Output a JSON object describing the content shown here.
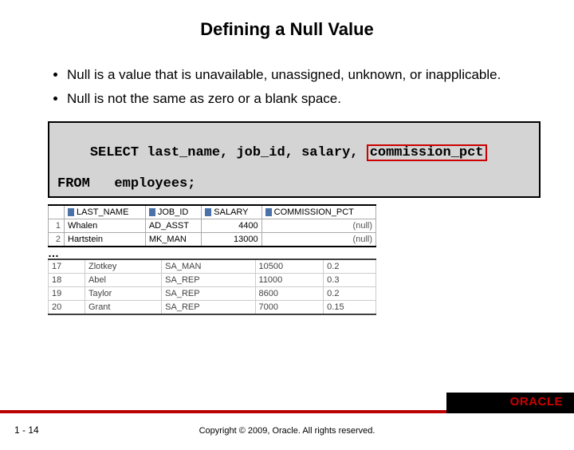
{
  "title": "Defining a Null Value",
  "bullets": [
    "Null is a value that is unavailable, unassigned, unknown, or inapplicable.",
    "Null is not the same as zero or a blank space."
  ],
  "sql": {
    "select_kw": "SELECT ",
    "cols_pre": "last_name, job_id, salary, ",
    "cols_hl": "commission_pct",
    "from_line": "FROM   employees;"
  },
  "grid_headers": [
    "LAST_NAME",
    "JOB_ID",
    "SALARY",
    "COMMISSION_PCT"
  ],
  "rows1": [
    {
      "n": "1",
      "last": "Whalen",
      "job": "AD_ASST",
      "sal": "4400",
      "comm": "(null)"
    },
    {
      "n": "2",
      "last": "Hartstein",
      "job": "MK_MAN",
      "sal": "13000",
      "comm": "(null)"
    }
  ],
  "rows2": [
    {
      "n": "17",
      "last": "Zlotkey",
      "job": "SA_MAN",
      "sal": "10500",
      "comm": "0.2"
    },
    {
      "n": "18",
      "last": "Abel",
      "job": "SA_REP",
      "sal": "11000",
      "comm": "0.3"
    },
    {
      "n": "19",
      "last": "Taylor",
      "job": "SA_REP",
      "sal": "8600",
      "comm": "0.2"
    },
    {
      "n": "20",
      "last": "Grant",
      "job": "SA_REP",
      "sal": "7000",
      "comm": "0.15"
    }
  ],
  "ellipsis": "…",
  "page_num": "1 - 14",
  "copyright": "Copyright © 2009, Oracle. All rights reserved.",
  "logo_text": "ORACLE"
}
